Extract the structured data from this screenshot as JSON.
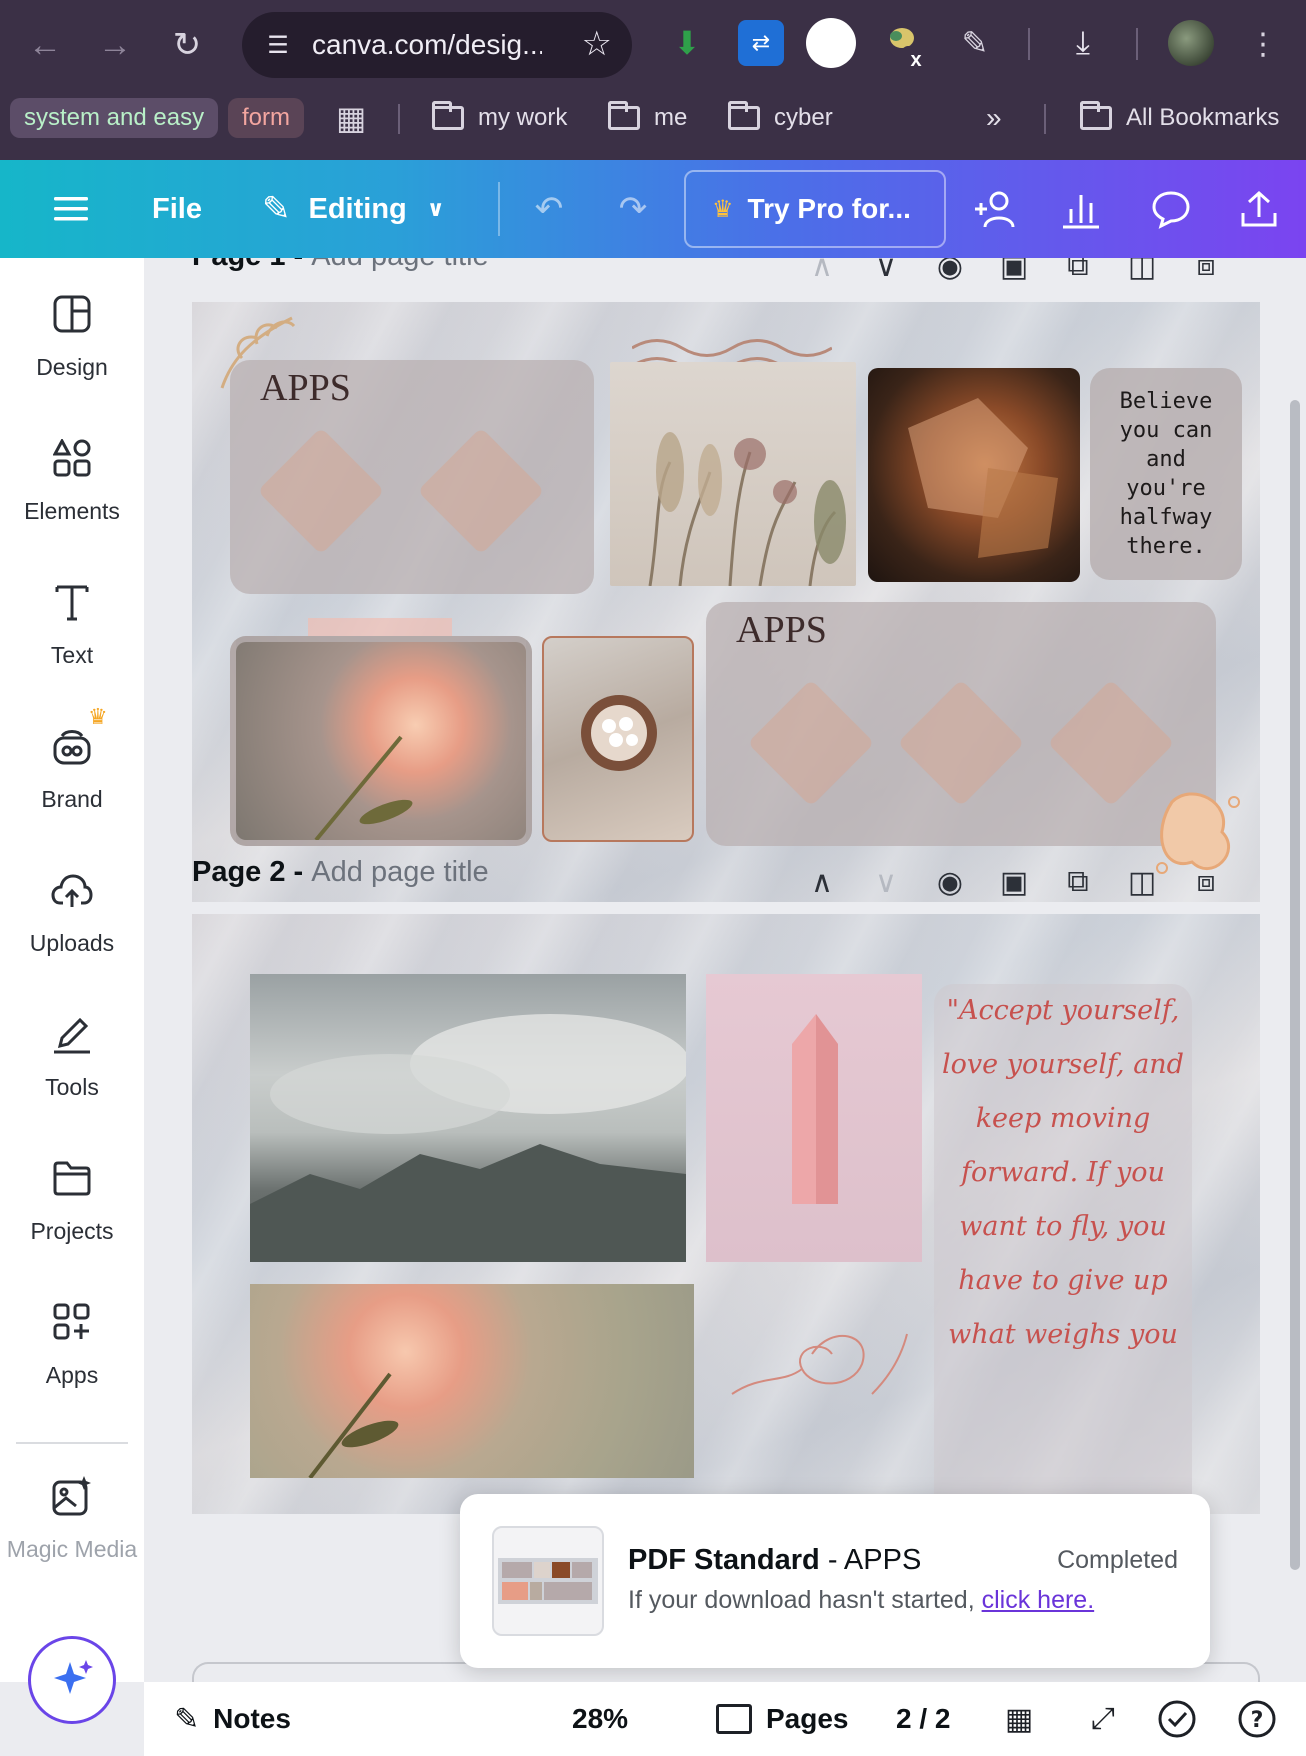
{
  "browser": {
    "url": "canva.com/desig...",
    "bookmarks": [
      {
        "label": "system and easy"
      },
      {
        "label": "form"
      },
      {
        "label": "my work"
      },
      {
        "label": "me"
      },
      {
        "label": "cyber"
      }
    ],
    "all_bookmarks": "All Bookmarks",
    "extension_badge": "x"
  },
  "toolbar": {
    "file": "File",
    "editing": "Editing",
    "try_pro": "Try Pro for..."
  },
  "sidebar": {
    "items": [
      {
        "label": "Design"
      },
      {
        "label": "Elements"
      },
      {
        "label": "Text"
      },
      {
        "label": "Brand"
      },
      {
        "label": "Uploads"
      },
      {
        "label": "Tools"
      },
      {
        "label": "Projects"
      },
      {
        "label": "Apps"
      },
      {
        "label": "Magic Media"
      }
    ]
  },
  "pages": [
    {
      "number": "Page 1 -",
      "title_placeholder": "Add page title",
      "apps_label_1": "APPS",
      "apps_label_2": "APPS",
      "quote": "Believe you can and you're halfway there."
    },
    {
      "number": "Page 2 -",
      "title_placeholder": "Add page title",
      "quote": "\"Accept yourself, love yourself, and keep moving forward. If you want to fly, you have to give up what weighs you"
    }
  ],
  "toast": {
    "title": "PDF Standard",
    "design_name": "- APPS",
    "status": "Completed",
    "message": "If your download hasn't started,",
    "link": "click here."
  },
  "bottombar": {
    "notes": "Notes",
    "zoom": "28%",
    "pages": "Pages",
    "page_count": "2 / 2"
  },
  "colors": {
    "toolbar_gradient_start": "#16b6c9",
    "toolbar_gradient_end": "#7b44f0",
    "link": "#6a34d9",
    "quote_red": "#c7514e"
  }
}
